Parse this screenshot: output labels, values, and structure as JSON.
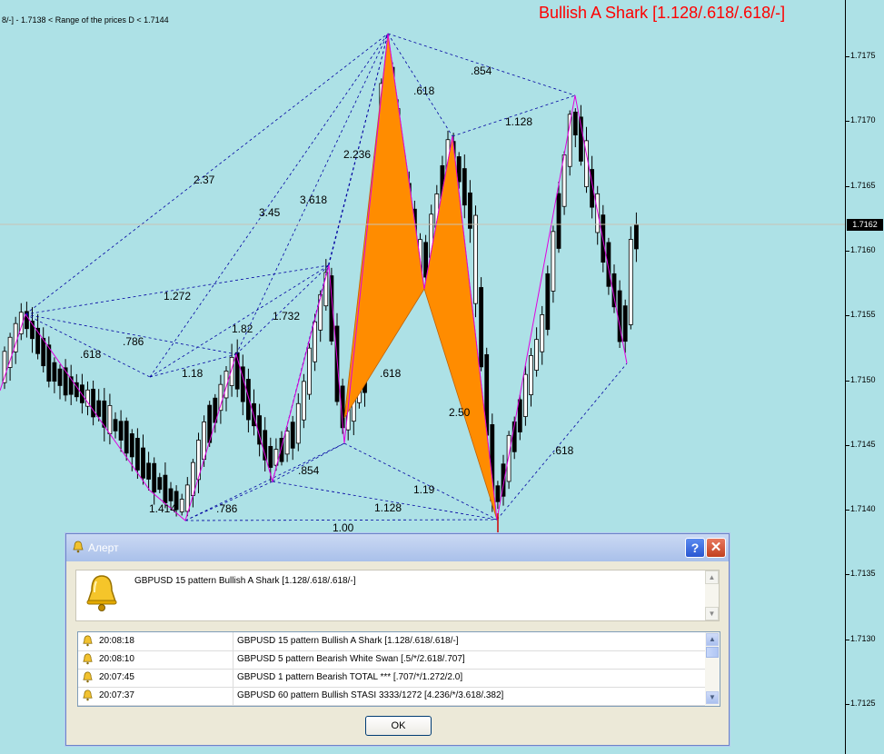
{
  "chart": {
    "info_line": "8/-] - 1.7138 < Range of the prices D < 1.7144",
    "pattern_title": "Bullish A Shark [1.128/.618/.618/-]",
    "current_price": "1.7162",
    "price_ticks": [
      "1.7175",
      "1.7170",
      "1.7165",
      "1.7160",
      "1.7155",
      "1.7150",
      "1.7145",
      "1.7140",
      "1.7135",
      "1.7130",
      "1.7125"
    ],
    "ratio_labels": [
      "2.37",
      "3.45",
      "3.618",
      "2.236",
      ".618",
      ".854",
      "1.128",
      "1.272",
      ".786",
      ".618",
      "1.82",
      "1.732",
      "1.18",
      ".618",
      "2.50",
      "1.19",
      ".618",
      ".854",
      "1.414",
      ".786",
      "1.128",
      "1.00"
    ],
    "colors": {
      "background": "#ade1e6",
      "pattern_fill": "#ff8c00",
      "zigzag": "#e000e0",
      "dotted": "#0000a0",
      "bull_candle": "#ffffff",
      "bear_candle": "#000000",
      "title": "#ff0000"
    }
  },
  "dialog": {
    "title": "Алерт",
    "help_label": "?",
    "close_label": "✕",
    "message": "GBPUSD 15 pattern Bullish A Shark [1.128/.618/.618/-]",
    "rows": [
      {
        "time": "20:08:18",
        "text": "GBPUSD 15 pattern Bullish A Shark [1.128/.618/.618/-]"
      },
      {
        "time": "20:08:10",
        "text": "GBPUSD 5 pattern Bearish White Swan [.5/*/2.618/.707]"
      },
      {
        "time": "20:07:45",
        "text": "GBPUSD 1 pattern Bearish TOTAL *** [.707/*/1.272/2.0]"
      },
      {
        "time": "20:07:37",
        "text": "GBPUSD 60 pattern Bullish STASI 3333/1272 [4.236/*/3.618/.382]"
      }
    ],
    "ok_label": "OK",
    "icons": [
      "bell-icon",
      "help-icon",
      "close-icon",
      "scroll-up-icon",
      "scroll-down-icon"
    ]
  }
}
